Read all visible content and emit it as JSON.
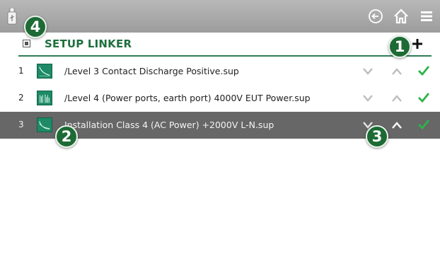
{
  "topbar": {
    "usb_icon": "usb-icon",
    "back_icon": "back-arrow-icon",
    "home_icon": "home-icon",
    "menu_icon": "hamburger-menu-icon"
  },
  "header": {
    "title": "SETUP LINKER",
    "add_icon": "plus-icon"
  },
  "rows": [
    {
      "num": "1",
      "name": "/Level 3 Contact Discharge Positive.sup",
      "thumb_icon": "waveform-decay-icon",
      "selected": false
    },
    {
      "num": "2",
      "name": "/Level 4 (Power ports, earth port) 4000V EUT Power.sup",
      "thumb_icon": "waveform-bursts-icon",
      "selected": false
    },
    {
      "num": "3",
      "name": "Installation Class 4 (AC Power) +2000V L-N.sup",
      "thumb_icon": "waveform-surge-icon",
      "selected": true
    }
  ],
  "callouts": [
    "1",
    "2",
    "3",
    "4"
  ],
  "colors": {
    "accent": "#1e6f3e",
    "check": "#2db34a",
    "selected_row": "#676767",
    "topbar": "#aaaaaa",
    "callout": "#1d6a34"
  }
}
